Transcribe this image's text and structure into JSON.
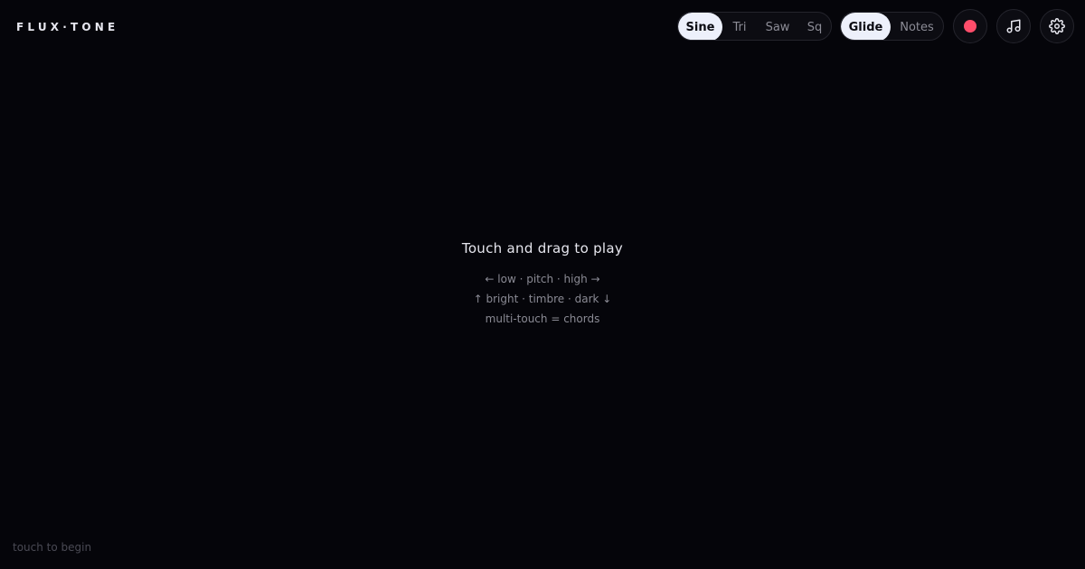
{
  "app": {
    "logo": "FLUX·TONE"
  },
  "waveform": {
    "options": [
      "Sine",
      "Tri",
      "Saw",
      "Sq"
    ],
    "selected": "Sine"
  },
  "mode": {
    "options": [
      "Glide",
      "Notes"
    ],
    "selected": "Glide"
  },
  "toolbar": {
    "record_icon": "record-dot",
    "notes_icon": "music-note-icon",
    "settings_icon": "gear-icon"
  },
  "instructions": {
    "headline": "Touch and drag to play",
    "pitch_line": "← low · pitch · high →",
    "timbre_line": "↑ bright · timbre · dark ↓",
    "chords_line": "multi-touch = chords"
  },
  "status": {
    "text": "touch to begin"
  },
  "colors": {
    "background": "#05050a",
    "active_segment": "#edf0fb",
    "record": "#ff4d6a"
  }
}
